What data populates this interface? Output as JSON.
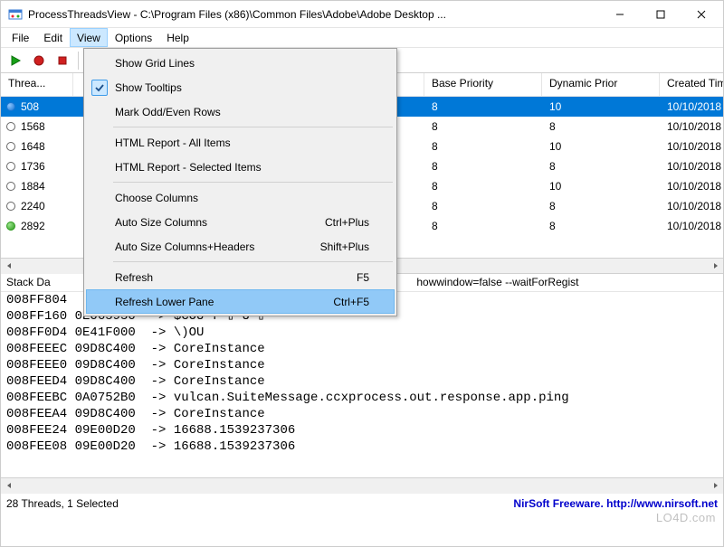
{
  "window": {
    "title": "ProcessThreadsView  -  C:\\Program Files (x86)\\Common Files\\Adobe\\Adobe Desktop ...",
    "min": "—",
    "max": "☐",
    "close": "✕"
  },
  "menu": {
    "file": "File",
    "edit": "Edit",
    "view": "View",
    "options": "Options",
    "help": "Help"
  },
  "view_menu": {
    "grid": "Show Grid Lines",
    "tooltips": "Show Tooltips",
    "mark": "Mark Odd/Even Rows",
    "html_all": "HTML Report - All Items",
    "html_sel": "HTML Report - Selected Items",
    "choose": "Choose Columns",
    "autosize": "Auto Size Columns",
    "autosize_sc": "Ctrl+Plus",
    "autosize_h": "Auto Size Columns+Headers",
    "autosize_h_sc": "Shift+Plus",
    "refresh": "Refresh",
    "refresh_sc": "F5",
    "refresh_low": "Refresh Lower Pane",
    "refresh_low_sc": "Ctrl+F5"
  },
  "left_header": "Threa...",
  "left_rows": [
    {
      "id": "508",
      "cls": "blue"
    },
    {
      "id": "1568",
      "cls": ""
    },
    {
      "id": "1648",
      "cls": ""
    },
    {
      "id": "1736",
      "cls": ""
    },
    {
      "id": "1884",
      "cls": ""
    },
    {
      "id": "2240",
      "cls": ""
    },
    {
      "id": "2892",
      "cls": "green"
    }
  ],
  "right_headers": {
    "base": "Base Priority",
    "dyn": "Dynamic Prior",
    "created": "Created Tim"
  },
  "right_rows": [
    {
      "base": "8",
      "dyn": "10",
      "created": "10/10/2018"
    },
    {
      "base": "8",
      "dyn": "8",
      "created": "10/10/2018"
    },
    {
      "base": "8",
      "dyn": "10",
      "created": "10/10/2018"
    },
    {
      "base": "8",
      "dyn": "8",
      "created": "10/10/2018"
    },
    {
      "base": "8",
      "dyn": "10",
      "created": "10/10/2018"
    },
    {
      "base": "8",
      "dyn": "8",
      "created": "10/10/2018"
    },
    {
      "base": "8",
      "dyn": "8",
      "created": "10/10/2018"
    }
  ],
  "stack_header": "Stack Da",
  "stack_tail": "howwindow=false --waitForRegist",
  "stack_lines": "008FF804\n008FF160 0E065950  -> $COU f-▯ U-▯\n008FF0D4 0E41F000  -> \\)OU\n008FEEEC 09D8C400  -> CoreInstance\n008FEEE0 09D8C400  -> CoreInstance\n008FEED4 09D8C400  -> CoreInstance\n008FEEBC 0A0752B0  -> vulcan.SuiteMessage.ccxprocess.out.response.app.ping\n008FEEA4 09D8C400  -> CoreInstance\n008FEE24 09E00D20  -> 16688.1539237306\n008FEE08 09E00D20  -> 16688.1539237306",
  "status_left": "28 Threads, 1 Selected",
  "status_right": "NirSoft Freeware.  http://www.nirsoft.net",
  "watermark": "LO4D.com"
}
